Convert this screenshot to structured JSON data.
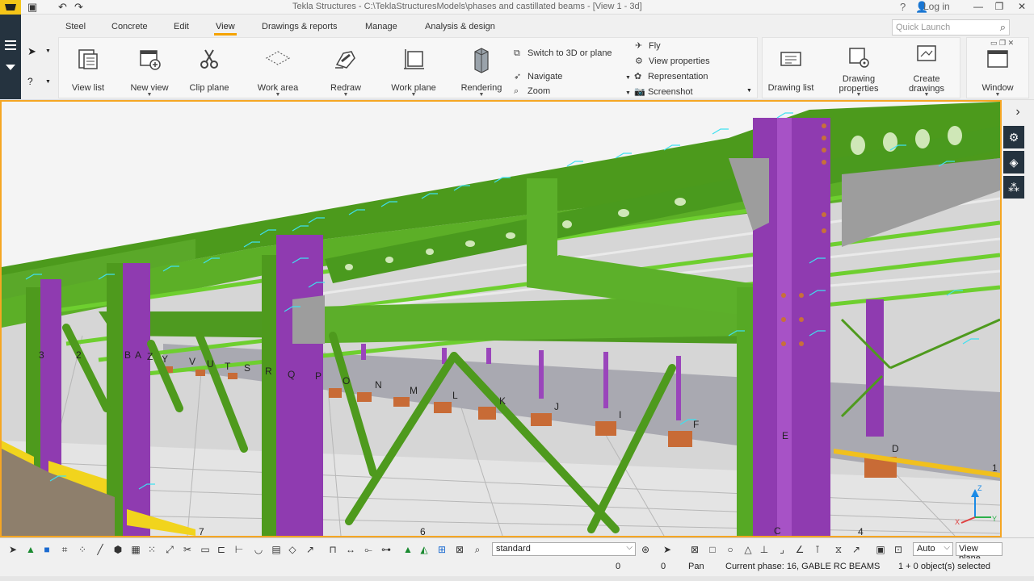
{
  "window": {
    "title": "Tekla Structures - C:\\TeklaStructuresModels\\phases and castillated beams  - [View 1 - 3d]",
    "login_label": "Log in",
    "help": "?",
    "minimize": "—",
    "maximize": "❐",
    "close": "✕"
  },
  "ribbon": {
    "tabs": [
      {
        "label": "Steel"
      },
      {
        "label": "Concrete"
      },
      {
        "label": "Edit"
      },
      {
        "label": "View"
      },
      {
        "label": "Drawings & reports"
      },
      {
        "label": "Manage"
      },
      {
        "label": "Analysis & design"
      }
    ],
    "active_tab": "View",
    "quick_launch_placeholder": "Quick Launch",
    "buttons": {
      "view_list": "View list",
      "new_view": "New view",
      "clip_plane": "Clip plane",
      "work_area": "Work area",
      "redraw": "Redraw",
      "work_plane": "Work plane",
      "rendering": "Rendering",
      "switch_3d": "Switch to 3D or plane",
      "navigate": "Navigate",
      "zoom": "Zoom",
      "fly": "Fly",
      "view_properties": "View properties",
      "representation": "Representation",
      "screenshot": "Screenshot",
      "drawing_list": "Drawing list",
      "drawing_properties_1": "Drawing",
      "drawing_properties_2": "properties",
      "create_drawings_1": "Create",
      "create_drawings_2": "drawings",
      "window": "Window"
    }
  },
  "viewport": {
    "grid_labels": [
      "A",
      "B",
      "Z",
      "Y",
      "V",
      "U",
      "T",
      "S",
      "R",
      "Q",
      "P",
      "O",
      "N",
      "M",
      "L",
      "K",
      "J",
      "I",
      "F",
      "E",
      "D",
      "C",
      "3",
      "2",
      "1",
      "4",
      "6",
      "7"
    ],
    "axis_labels": [
      "X",
      "Y",
      "Z"
    ]
  },
  "bottom_toolbar": {
    "filter_value": "standard",
    "snap_mode": "Auto",
    "view_plane": "View plane"
  },
  "status": {
    "coord_x": "0",
    "coord_y": "0",
    "mode": "Pan",
    "phase": "Current phase: 16, GABLE RC BEAMS",
    "selection": "1 + 0 object(s) selected"
  }
}
